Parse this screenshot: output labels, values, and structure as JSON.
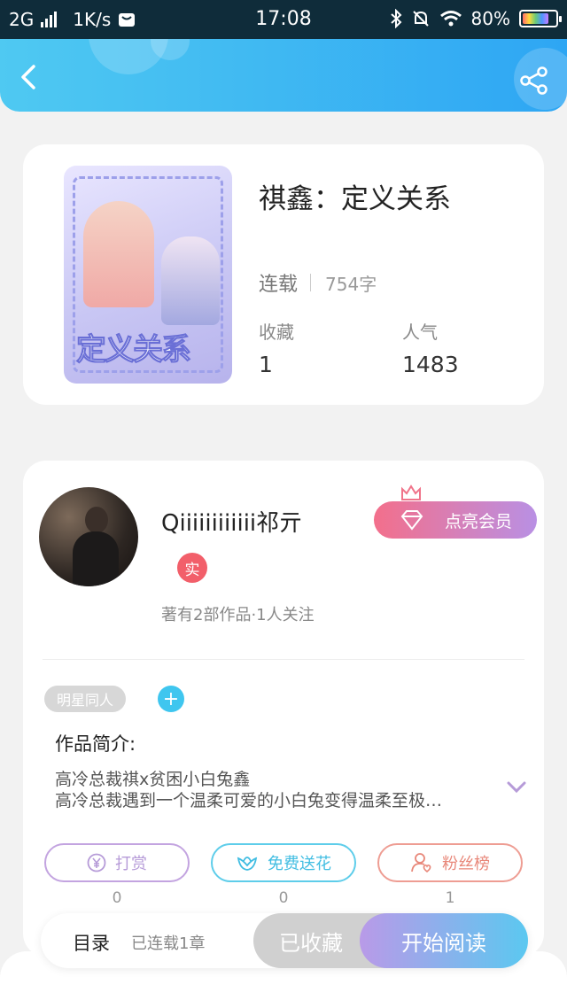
{
  "status_bar": {
    "network": "2G",
    "speed": "1K/s",
    "time": "17:08",
    "battery": "80%",
    "battery_level": 0.8
  },
  "header": {
    "back_icon": "chevron-left-icon",
    "share_icon": "share-icon"
  },
  "book": {
    "title": "祺鑫：定义关系",
    "cover_title": "定义关系",
    "status": "连载",
    "word_count": "754字",
    "favorites_label": "收藏",
    "favorites_value": "1",
    "popularity_label": "人气",
    "popularity_value": "1483"
  },
  "author": {
    "name": "Qiiiiiiiiiiii祁亓",
    "verified_badge": "实",
    "works_info": "著有2部作品·1人关注",
    "vip_button": "点亮会员"
  },
  "tags": [
    "明星同人"
  ],
  "intro": {
    "heading": "作品简介:",
    "line1": "高冷总裁祺x贫困小白兔鑫",
    "line2": "高冷总裁遇到一个温柔可爱的小白兔变得温柔至极…"
  },
  "actions": [
    {
      "label": "打赏",
      "icon": "yen-icon",
      "count": "0"
    },
    {
      "label": "免费送花",
      "icon": "flower-icon",
      "count": "0"
    },
    {
      "label": "粉丝榜",
      "icon": "fan-icon",
      "count": "1"
    }
  ],
  "bottom_bar": {
    "toc": "目录",
    "serial_status": "已连载1章",
    "favorited": "已收藏",
    "start_reading": "开始阅读"
  },
  "colors": {
    "header_start": "#4fc9f2",
    "header_end": "#2ea6f3",
    "vip_start": "#f36f8b",
    "vip_end": "#b990e4",
    "badge": "#f25f6a",
    "read_start": "#b99ae8",
    "read_end": "#5bc8f0"
  }
}
